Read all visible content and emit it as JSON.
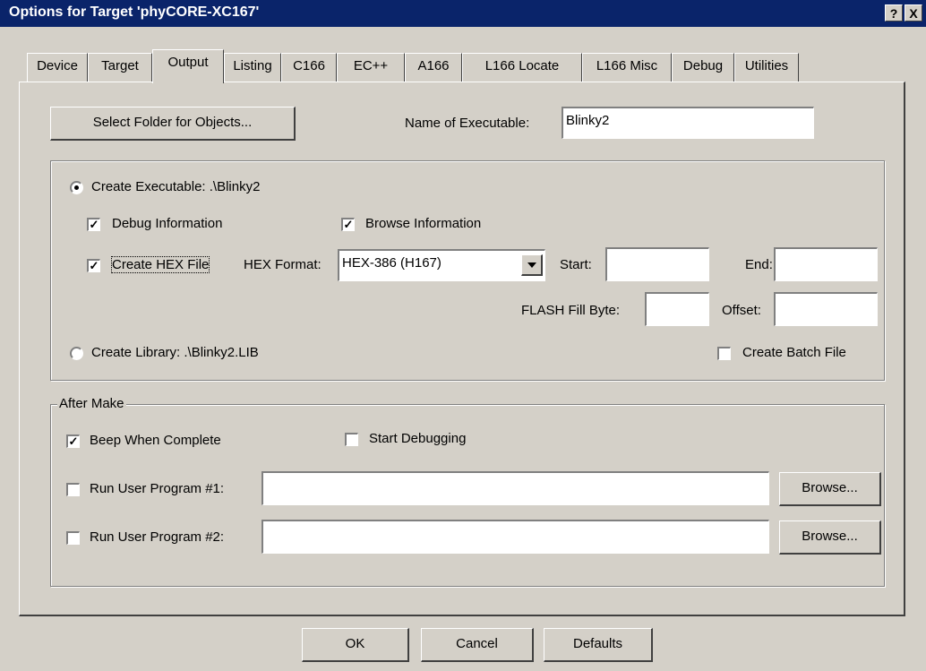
{
  "window": {
    "title": "Options for Target 'phyCORE-XC167'",
    "help_button": "?",
    "close_button": "X"
  },
  "tabs": [
    {
      "label": "Device"
    },
    {
      "label": "Target"
    },
    {
      "label": "Output",
      "active": true
    },
    {
      "label": "Listing"
    },
    {
      "label": "C166"
    },
    {
      "label": "EC++"
    },
    {
      "label": "A166"
    },
    {
      "label": "L166 Locate"
    },
    {
      "label": "L166 Misc"
    },
    {
      "label": "Debug"
    },
    {
      "label": "Utilities"
    }
  ],
  "output": {
    "select_folder_label": "Select Folder for Objects...",
    "name_exec_label": "Name of Executable:",
    "name_exec_value": "Blinky2",
    "create_exec": {
      "label": "Create Executable:  .\\Blinky2",
      "selected": true
    },
    "debug_info": {
      "label": "Debug Information",
      "checked": true
    },
    "browse_info": {
      "label": "Browse Information",
      "checked": true
    },
    "create_hex": {
      "label": "Create HEX File",
      "checked": true
    },
    "hex_format_label": "HEX Format:",
    "hex_format_value": "HEX-386 (H167)",
    "start_label": "Start:",
    "start_value": "",
    "end_label": "End:",
    "end_value": "",
    "flash_fill_label": "FLASH Fill Byte:",
    "flash_fill_value": "",
    "offset_label": "Offset:",
    "offset_value": "",
    "create_library": {
      "label": "Create Library:  .\\Blinky2.LIB",
      "selected": false
    },
    "create_batch": {
      "label": "Create Batch File",
      "checked": false
    }
  },
  "after_make": {
    "group_label": "After Make",
    "beep": {
      "label": "Beep When Complete",
      "checked": true
    },
    "start_debugging": {
      "label": "Start Debugging",
      "checked": false
    },
    "run_user_1": {
      "label": "Run User Program #1:",
      "checked": false,
      "value": ""
    },
    "run_user_2": {
      "label": "Run User Program #2:",
      "checked": false,
      "value": ""
    },
    "browse_label": "Browse..."
  },
  "buttons": {
    "ok": "OK",
    "cancel": "Cancel",
    "defaults": "Defaults"
  },
  "colors": {
    "titlebar": "#0a246a",
    "face": "#d4d0c8"
  }
}
